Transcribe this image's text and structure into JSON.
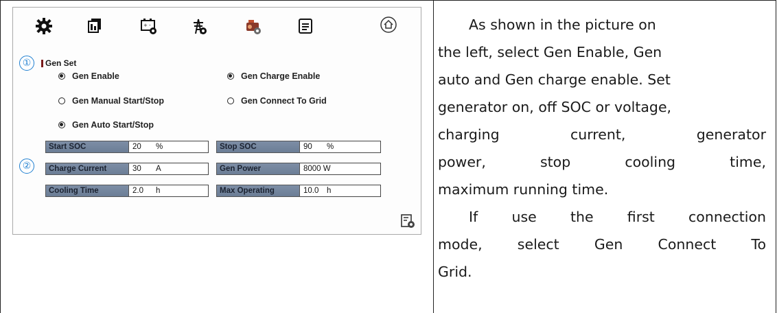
{
  "annotations": {
    "first": "①",
    "second": "②"
  },
  "toolbar": {
    "icons": [
      "gear-icon",
      "battery-settings-icon",
      "battery-gear-icon",
      "grid-tower-icon",
      "generator-icon",
      "document-icon",
      "home-icon"
    ]
  },
  "gen_set": {
    "title": "Gen Set",
    "options": {
      "gen_enable": {
        "label": "Gen Enable",
        "selected": true
      },
      "gen_charge_enable": {
        "label": "Gen Charge Enable",
        "selected": true
      },
      "gen_manual": {
        "label": "Gen Manual Start/Stop",
        "selected": false
      },
      "gen_connect_grid": {
        "label": "Gen Connect To Grid",
        "selected": false
      },
      "gen_auto": {
        "label": "Gen Auto Start/Stop",
        "selected": true
      }
    },
    "fields": {
      "start_soc": {
        "label": "Start SOC",
        "value": "20",
        "unit": "%"
      },
      "stop_soc": {
        "label": "Stop SOC",
        "value": "90",
        "unit": "%"
      },
      "charge_current": {
        "label": "Charge Current",
        "value": "30",
        "unit": "A"
      },
      "gen_power": {
        "label": "Gen Power",
        "value": "8000 W",
        "unit": ""
      },
      "cooling_time": {
        "label": "Cooling Time",
        "value": "2.0",
        "unit": "h"
      },
      "max_operating": {
        "label": "Max Operating",
        "value": "10.0",
        "unit": "h"
      }
    }
  },
  "description": {
    "p1_lines": [
      "As shown in the picture on",
      "the left, select Gen Enable, Gen",
      "auto and Gen charge enable. Set",
      "generator on, off SOC or voltage,",
      "charging current, generator",
      "power, stop cooling time,",
      "maximum running time."
    ],
    "p2_lines": [
      "If use the first connection",
      "mode, select Gen Connect To",
      "Grid."
    ]
  }
}
